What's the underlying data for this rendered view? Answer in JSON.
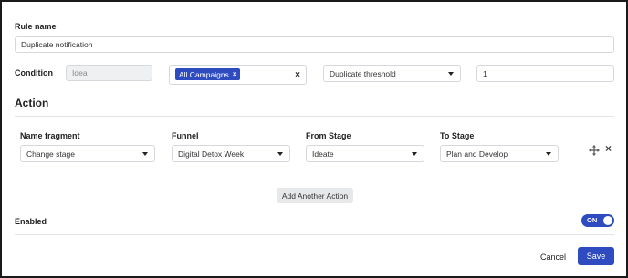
{
  "rule": {
    "name_label": "Rule name",
    "name_value": "Duplicate notification"
  },
  "condition": {
    "label": "Condition",
    "type_value": "Idea",
    "campaign_chip": "All Campaigns",
    "chip_remove": "×",
    "clear": "×",
    "threshold_select": "Duplicate threshold",
    "threshold_value": "1"
  },
  "action": {
    "title": "Action",
    "columns": {
      "name_fragment": "Name fragment",
      "funnel": "Funnel",
      "from_stage": "From Stage",
      "to_stage": "To Stage"
    },
    "row": {
      "name_fragment": "Change stage",
      "funnel": "Digital Detox Week",
      "from_stage": "Ideate",
      "to_stage": "Plan and Develop"
    },
    "move_icon": "move-icon",
    "remove": "×",
    "add_button": "Add Another Action"
  },
  "enabled": {
    "label": "Enabled",
    "toggle_text": "ON"
  },
  "footer": {
    "cancel": "Cancel",
    "save": "Save"
  },
  "colors": {
    "accent": "#2e4bbf"
  }
}
